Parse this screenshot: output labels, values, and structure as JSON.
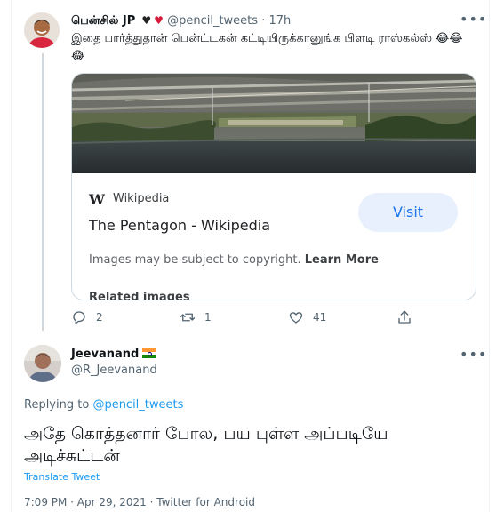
{
  "tweet1": {
    "name": "பென்சில் JP",
    "handle": "@pencil_tweets",
    "separator": "·",
    "time": "17h",
    "text": "இதை பார்த்துதான் பென்ட்டகன் கட்டியிருக்கானுங்க பிளடி ராஸ்கல்ஸ் 😂😂😂",
    "more": "•••",
    "card": {
      "logo": "W",
      "source": "Wikipedia",
      "title": "The Pentagon - Wikipedia",
      "visit_label": "Visit",
      "copyright_text": "Images may be subject to copyright.",
      "learn_more": "Learn More",
      "related": "Related images"
    },
    "actions": {
      "replies": "2",
      "retweets": "1",
      "likes": "41"
    }
  },
  "tweet2": {
    "name": "Jeevanand",
    "handle": "@R_Jeevanand",
    "more": "•••",
    "replying_prefix": "Replying to",
    "replying_to": "@pencil_tweets",
    "text": "அதே கொத்தனார் போல, பய புள்ள அப்படியே அடிச்சுட்டன்",
    "translate": "Translate Tweet",
    "meta": "7:09 PM · Apr 29, 2021 · Twitter for Android"
  },
  "colors": {
    "accent": "#1d9bf0",
    "muted": "#536471",
    "visit_bg": "#e8f0fe",
    "visit_text": "#1a73e8"
  },
  "icons": {
    "reply": "reply-icon",
    "retweet": "retweet-icon",
    "like": "heart-icon",
    "share": "share-icon",
    "more": "more-icon",
    "flag": "india-flag-icon",
    "wiki": "wikipedia-logo-icon"
  }
}
